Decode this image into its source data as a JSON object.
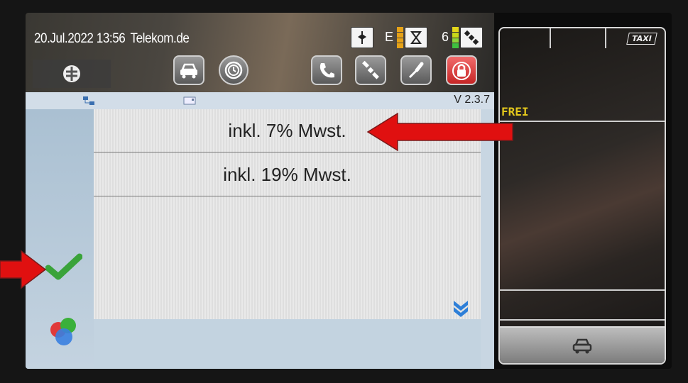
{
  "status": {
    "datetime": "20.Jul.2022 13:56",
    "network": "Telekom.de",
    "net_letter": "E",
    "sat_count": "6"
  },
  "toolbar": {
    "buttons": [
      "logo-icon",
      "taxi-icon",
      "clock-icon",
      "phone-icon",
      "satellite-icon",
      "tool-icon",
      "lock-icon"
    ]
  },
  "content": {
    "version": "V 2.3.7",
    "options": [
      "inkl. 7% Mwst.",
      "inkl. 19% Mwst."
    ]
  },
  "taxi_panel": {
    "badge": "TAXI",
    "status": "FREI"
  },
  "colors": {
    "confirm": "#3aa33a",
    "arrow": "#e01010",
    "status_frei": "#e4c81c",
    "lock_button": "#d43a3a"
  }
}
